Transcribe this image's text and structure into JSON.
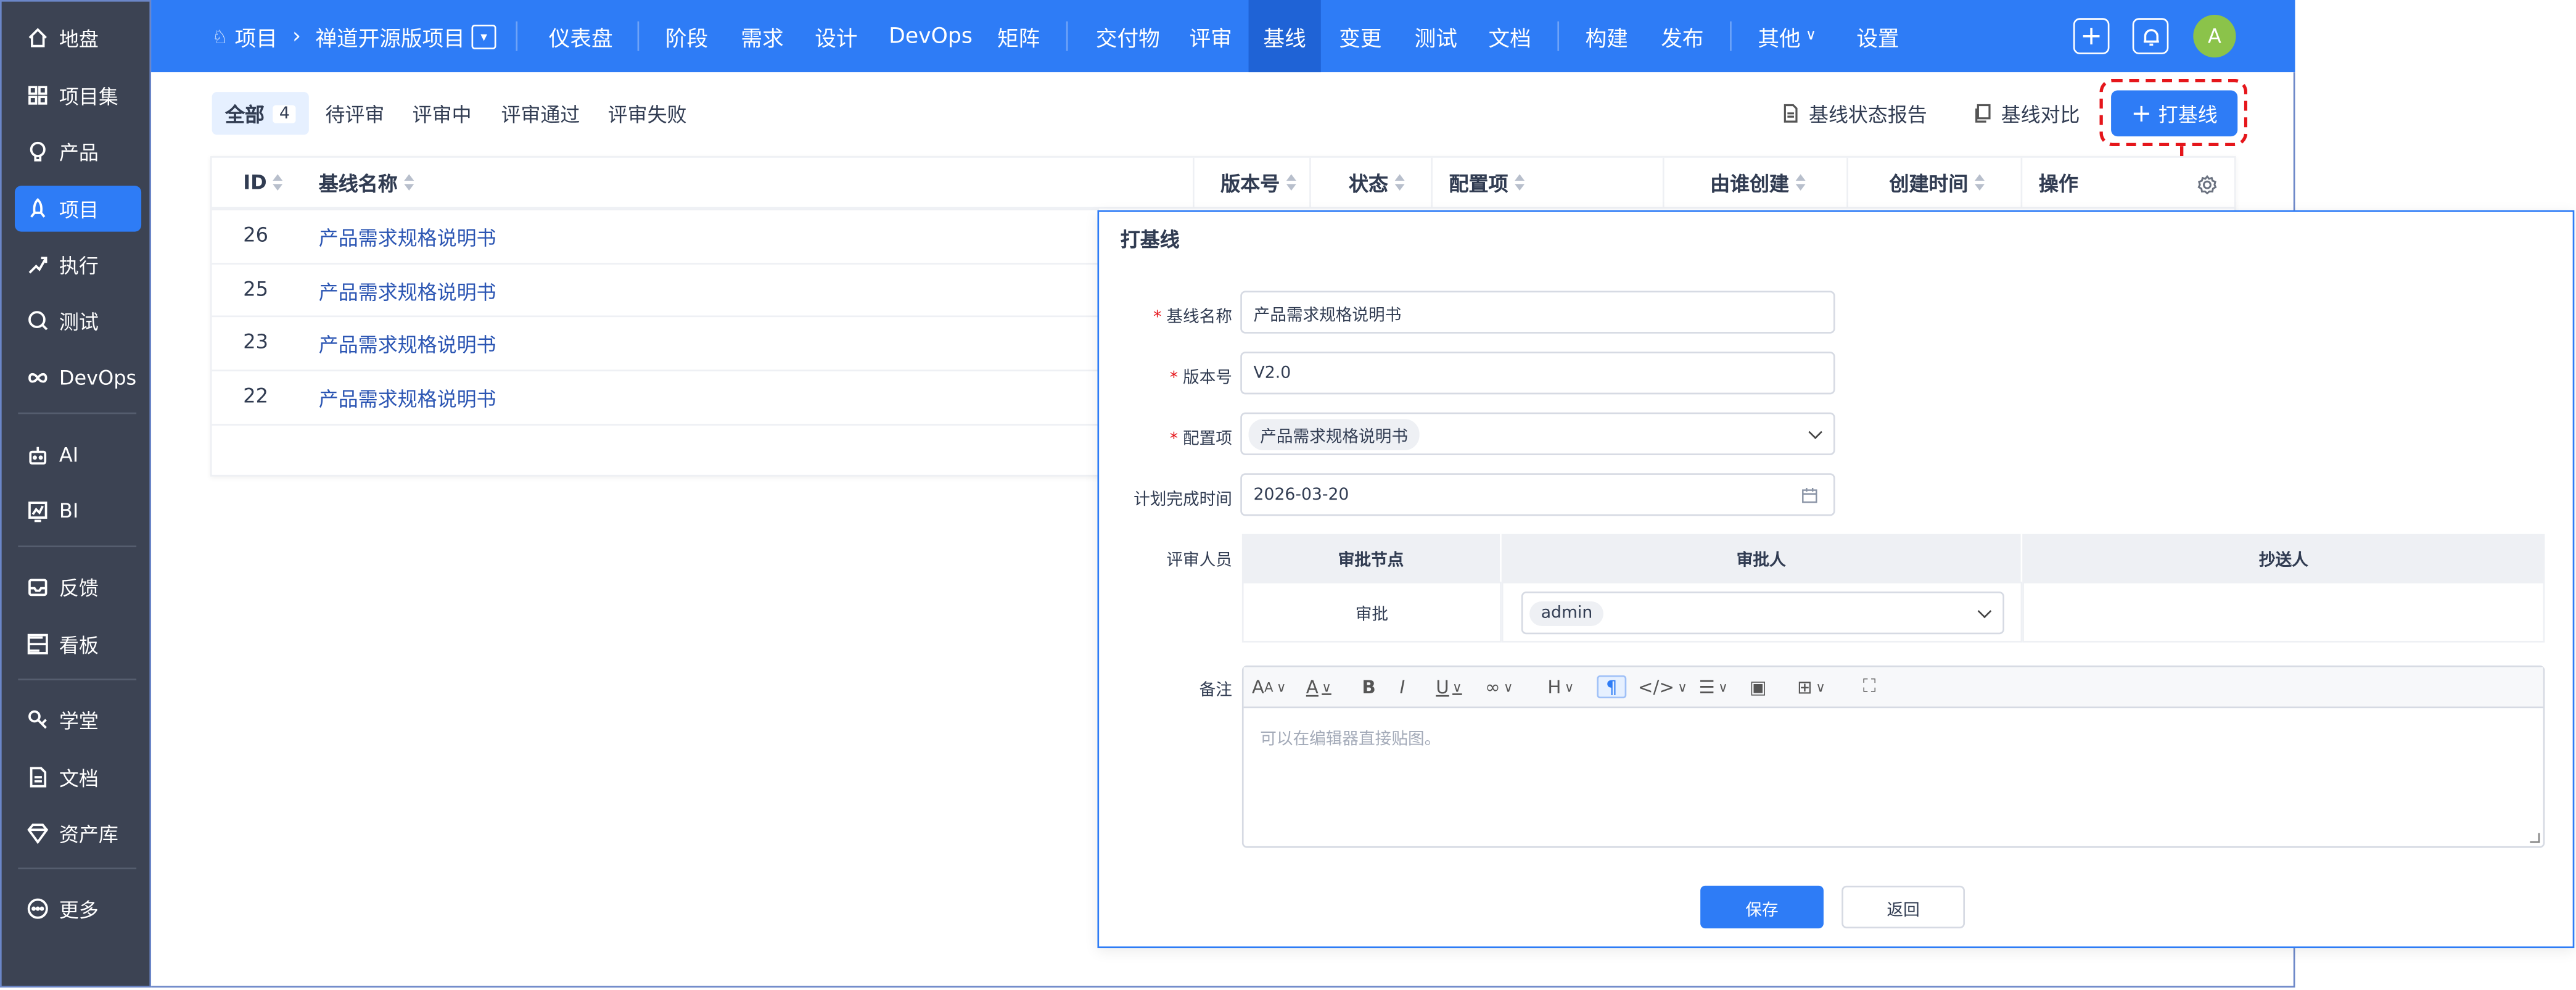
{
  "sidebar": {
    "items": [
      {
        "label": "地盘",
        "icon": "home-icon"
      },
      {
        "label": "项目集",
        "icon": "grid-icon"
      },
      {
        "label": "产品",
        "icon": "bulb-icon"
      },
      {
        "label": "项目",
        "icon": "rocket-icon"
      },
      {
        "label": "执行",
        "icon": "run-icon"
      },
      {
        "label": "测试",
        "icon": "search-icon"
      },
      {
        "label": "DevOps",
        "icon": "infinity-icon"
      },
      {
        "label": "AI",
        "icon": "robot-icon"
      },
      {
        "label": "BI",
        "icon": "chart-icon"
      },
      {
        "label": "反馈",
        "icon": "inbox-icon"
      },
      {
        "label": "看板",
        "icon": "board-icon"
      },
      {
        "label": "学堂",
        "icon": "school-icon"
      },
      {
        "label": "文档",
        "icon": "doc-icon"
      },
      {
        "label": "资产库",
        "icon": "diamond-icon"
      },
      {
        "label": "更多",
        "icon": "more-icon"
      }
    ],
    "active_index": 3
  },
  "topbar": {
    "section": "项目",
    "project": "禅道开源版项目",
    "nav": [
      "仪表盘",
      "阶段",
      "需求",
      "设计",
      "DevOps",
      "矩阵",
      "交付物",
      "评审",
      "基线",
      "变更",
      "测试",
      "文档",
      "构建",
      "发布",
      "其他",
      "设置"
    ],
    "active_nav": "基线",
    "avatar": "A"
  },
  "tabs": [
    {
      "label": "全部",
      "count": "4"
    },
    {
      "label": "待评审"
    },
    {
      "label": "评审中"
    },
    {
      "label": "评审通过"
    },
    {
      "label": "评审失败"
    }
  ],
  "toolbar": {
    "report": "基线状态报告",
    "compare": "基线对比",
    "create": "打基线"
  },
  "table": {
    "headers": [
      "ID",
      "基线名称",
      "版本号",
      "状态",
      "配置项",
      "由谁创建",
      "创建时间",
      "操作"
    ],
    "rows": [
      {
        "id": "26",
        "name": "产品需求规格说明书"
      },
      {
        "id": "25",
        "name": "产品需求规格说明书"
      },
      {
        "id": "23",
        "name": "产品需求规格说明书"
      },
      {
        "id": "22",
        "name": "产品需求规格说明书"
      }
    ]
  },
  "dialog": {
    "title": "打基线",
    "fields": {
      "name_label": "基线名称",
      "name_value": "产品需求规格说明书",
      "version_label": "版本号",
      "version_value": "V2.0",
      "config_label": "配置项",
      "config_value": "产品需求规格说明书",
      "date_label": "计划完成时间",
      "date_value": "2026-03-20",
      "reviewers_label": "评审人员",
      "remark_label": "备注",
      "remark_placeholder": "可以在编辑器直接贴图。"
    },
    "approval": {
      "headers": [
        "审批节点",
        "审批人",
        "抄送人"
      ],
      "node": "审批",
      "approver": "admin"
    },
    "save": "保存",
    "back": "返回"
  },
  "colors": {
    "primary": "#2e7cf6",
    "sidebar": "#3c4353",
    "highlight": "#e5161b"
  }
}
